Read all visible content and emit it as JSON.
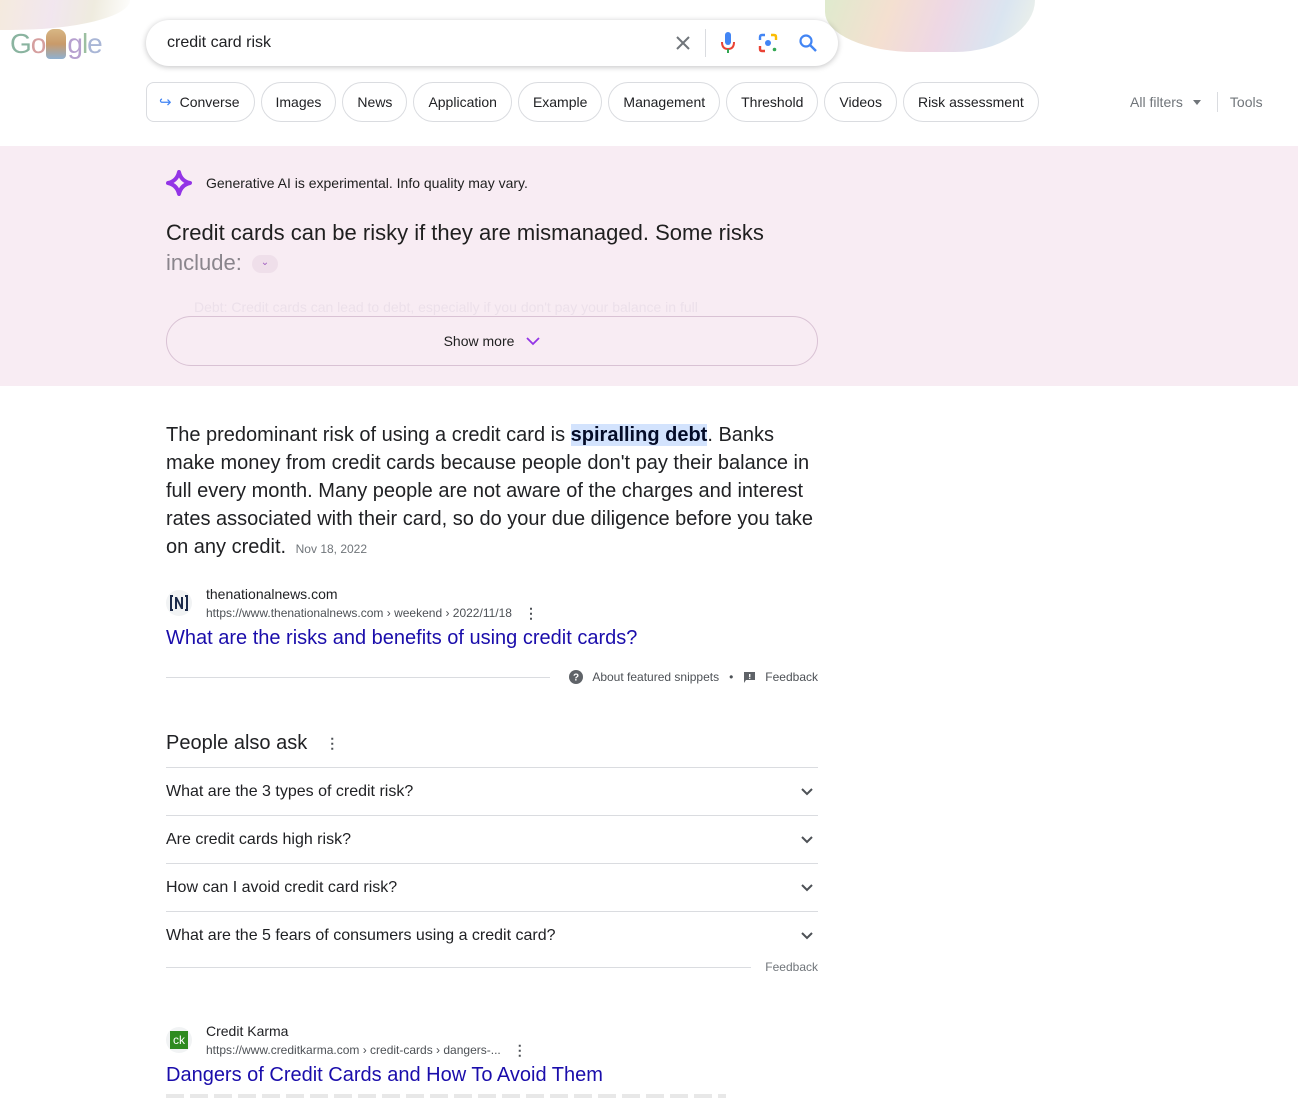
{
  "header": {
    "logo_text": "Google",
    "search_query": "credit card risk",
    "icons": [
      "close-icon",
      "microphone-icon",
      "google-lens-icon",
      "search-icon"
    ]
  },
  "chips": [
    {
      "label": "Converse",
      "icon": "converse-arrow-icon"
    },
    {
      "label": "Images"
    },
    {
      "label": "News"
    },
    {
      "label": "Application"
    },
    {
      "label": "Example"
    },
    {
      "label": "Management"
    },
    {
      "label": "Threshold"
    },
    {
      "label": "Videos"
    },
    {
      "label": "Risk assessment"
    }
  ],
  "filters": {
    "all_filters": "All filters",
    "tools": "Tools"
  },
  "sge": {
    "disclaimer": "Generative AI is experimental. Info quality may vary.",
    "summary_line": "Credit cards can be risky if they are mismanaged. Some risks",
    "summary_faded": "include:",
    "ghost_text": "Debt: Credit cards can lead to debt, especially if you don't pay your balance in full",
    "show_more": "Show more",
    "accent_color": "#9334e6"
  },
  "featured_snippet": {
    "text_before": "The predominant risk of using a credit card is ",
    "highlight": "spiralling debt",
    "text_after": ". Banks make money from credit cards because people don't pay their balance in full every month. Many people are not aware of the charges and interest rates associated with their card, so do your due diligence before you take on any credit.",
    "date": "Nov 18, 2022",
    "source": {
      "site": "thenationalnews.com",
      "url": "https://www.thenationalnews.com › weekend › 2022/11/18",
      "favicon_text": "N"
    },
    "title": "What are the risks and benefits of using credit cards?",
    "about": "About featured snippets",
    "feedback": "Feedback"
  },
  "people_also_ask": {
    "title": "People also ask",
    "questions": [
      "What are the 3 types of credit risk?",
      "Are credit cards high risk?",
      "How can I avoid credit card risk?",
      "What are the 5 fears of consumers using a credit card?"
    ],
    "feedback": "Feedback"
  },
  "results": [
    {
      "site": "Credit Karma",
      "url": "https://www.creditkarma.com › credit-cards › dangers-...",
      "favicon_text": "ck",
      "favicon_color": "#2e8b1f",
      "title": "Dangers of Credit Cards and How To Avoid Them"
    }
  ],
  "colors": {
    "link": "#1a0dab",
    "sge_bg": "#f8ecf3",
    "highlight_bg": "#d3e3fd"
  }
}
